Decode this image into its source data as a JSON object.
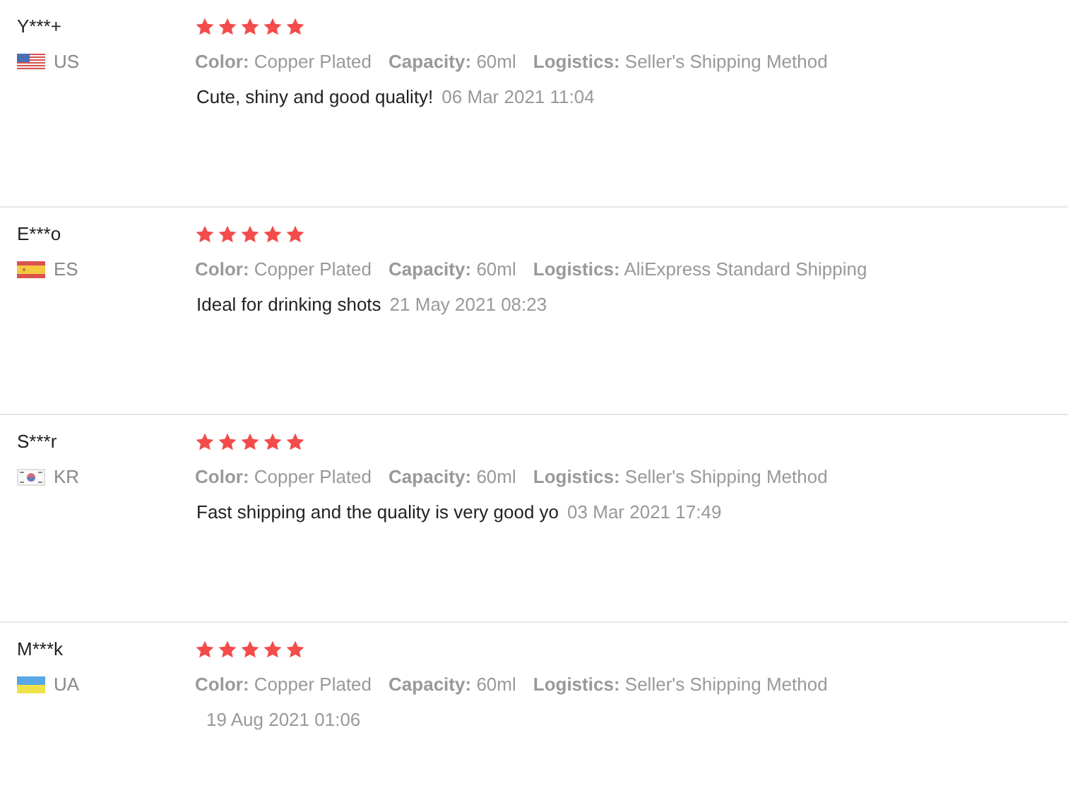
{
  "reviews": [
    {
      "name": "Y***+",
      "country": "US",
      "kind": "us",
      "stars": 5,
      "attributes": [
        {
          "label": "Color:",
          "value": "Copper Plated"
        },
        {
          "label": "Capacity:",
          "value": "60ml"
        },
        {
          "label": "Logistics:",
          "value": "Seller's Shipping Method"
        }
      ],
      "text": "Cute, shiny and good quality!",
      "date": "06 Mar 2021 11:04"
    },
    {
      "name": "E***o",
      "country": "ES",
      "kind": "es",
      "stars": 5,
      "attributes": [
        {
          "label": "Color:",
          "value": "Copper Plated"
        },
        {
          "label": "Capacity:",
          "value": "60ml"
        },
        {
          "label": "Logistics:",
          "value": "AliExpress Standard Shipping"
        }
      ],
      "text": "Ideal for drinking shots",
      "date": "21 May 2021 08:23"
    },
    {
      "name": "S***r",
      "country": "KR",
      "kind": "kr",
      "stars": 5,
      "attributes": [
        {
          "label": "Color:",
          "value": "Copper Plated"
        },
        {
          "label": "Capacity:",
          "value": "60ml"
        },
        {
          "label": "Logistics:",
          "value": "Seller's Shipping Method"
        }
      ],
      "text": "Fast shipping and the quality is very good yo",
      "date": "03 Mar 2021 17:49"
    },
    {
      "name": "M***k",
      "country": "UA",
      "kind": "ua",
      "stars": 5,
      "attributes": [
        {
          "label": "Color:",
          "value": "Copper Plated"
        },
        {
          "label": "Capacity:",
          "value": "60ml"
        },
        {
          "label": "Logistics:",
          "value": "Seller's Shipping Method"
        }
      ],
      "date": "19 Aug 2021 01:06"
    }
  ]
}
